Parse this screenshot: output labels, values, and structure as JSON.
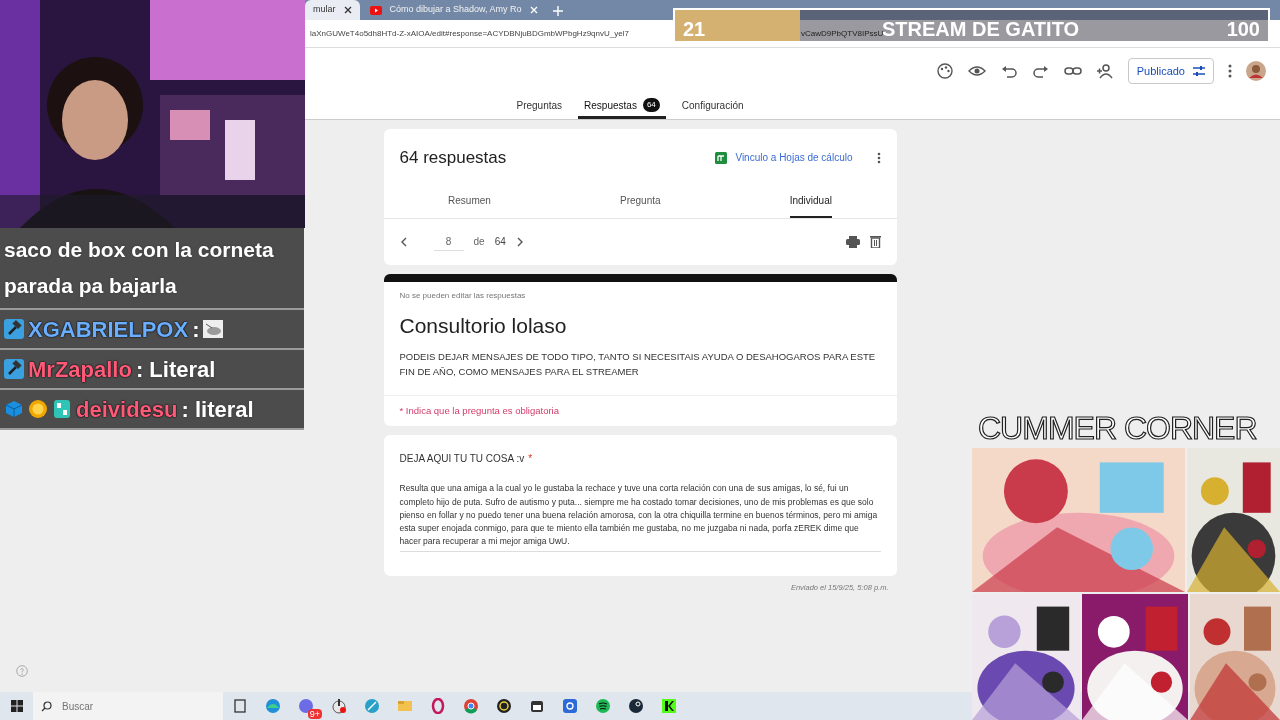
{
  "browser": {
    "tabs": [
      {
        "title": "mular",
        "selected": true
      },
      {
        "title": "Cómo dibujar a Shadow, Amy Ro",
        "selected": false
      }
    ],
    "url_start": "laXnGUWeT4o5dh8HTd-Z-xAIOA/edit#response=ACYDBNjuBDGmbWPbgHz9qnvU_yel7",
    "url_end": "vCawD9PbQTV8IPssU"
  },
  "form_toolbar": {
    "publish_button": "Publicado"
  },
  "form_tabs": [
    {
      "label": "Preguntas",
      "selected": false
    },
    {
      "label": "Respuestas",
      "badge": "64",
      "selected": true
    },
    {
      "label": "Configuración",
      "selected": false
    }
  ],
  "responses": {
    "title": "64 respuestas",
    "sheets_link": "Vinculo a Hojas de cálculo",
    "views": [
      {
        "label": "Resumen",
        "selected": false
      },
      {
        "label": "Pregunta",
        "selected": false
      },
      {
        "label": "Individual",
        "selected": true
      }
    ],
    "pager": {
      "current": "8",
      "of": "de",
      "total": "64"
    }
  },
  "form": {
    "notice": "No se pueden editar las respuestas",
    "title": "Consultorio lolaso",
    "description": "PODEIS DEJAR MENSAJES DE TODO TIPO, TANTO SI NECESITAIS AYUDA O DESAHOGAROS PARA ESTE FIN DE AÑO, COMO MENSAJES PARA EL STREAMER",
    "required_note": "* Indica que la pregunta es obligatoria"
  },
  "question": {
    "label": "DEJA AQUI TU TU COSA :v",
    "required_mark": "*",
    "answer": "Resulta que una amiga a la cual yo le gustaba la rechace y tuve una corta relación con una de sus amigas, lo sé, fui un completo hijo de puta. Sufro de autismo y puta... siempre me ha costado tomar decisiones, uno de mis problemas es que solo pienso en follar y no puedo tener una buena relación amorosa, con la otra chiquilla termine en buenos términos, pero mi amiga esta super enojada conmigo, para que te miento ella también me gustaba, no me juzgaba ni nada, porfa zEREK dime que hacer para recuperar a mi mejor amiga UwU."
  },
  "submitted": "Enviado el 15/9/25, 5:08 p.m.",
  "stream_goal": {
    "count": "21",
    "title": "STREAM DE GATITO",
    "target": "100",
    "level": 0.21
  },
  "chat": {
    "continued": "saco de box con la corneta parada pa bajarla",
    "messages": [
      {
        "user": "XGABRIELPOX",
        "color": "#6aaeff",
        "kind": "emote",
        "text": ":"
      },
      {
        "user": "MrZapallo",
        "color": "#ff5a78",
        "kind": "text",
        "text": ": Literal"
      },
      {
        "user": "deividesu",
        "color": "#ff5a78",
        "kind": "text",
        "text": ": literal"
      }
    ]
  },
  "gallery": {
    "caption": "CUMMER CORNER"
  },
  "taskbar": {
    "search_placeholder": "Buscar",
    "chat_badge": "9+"
  }
}
